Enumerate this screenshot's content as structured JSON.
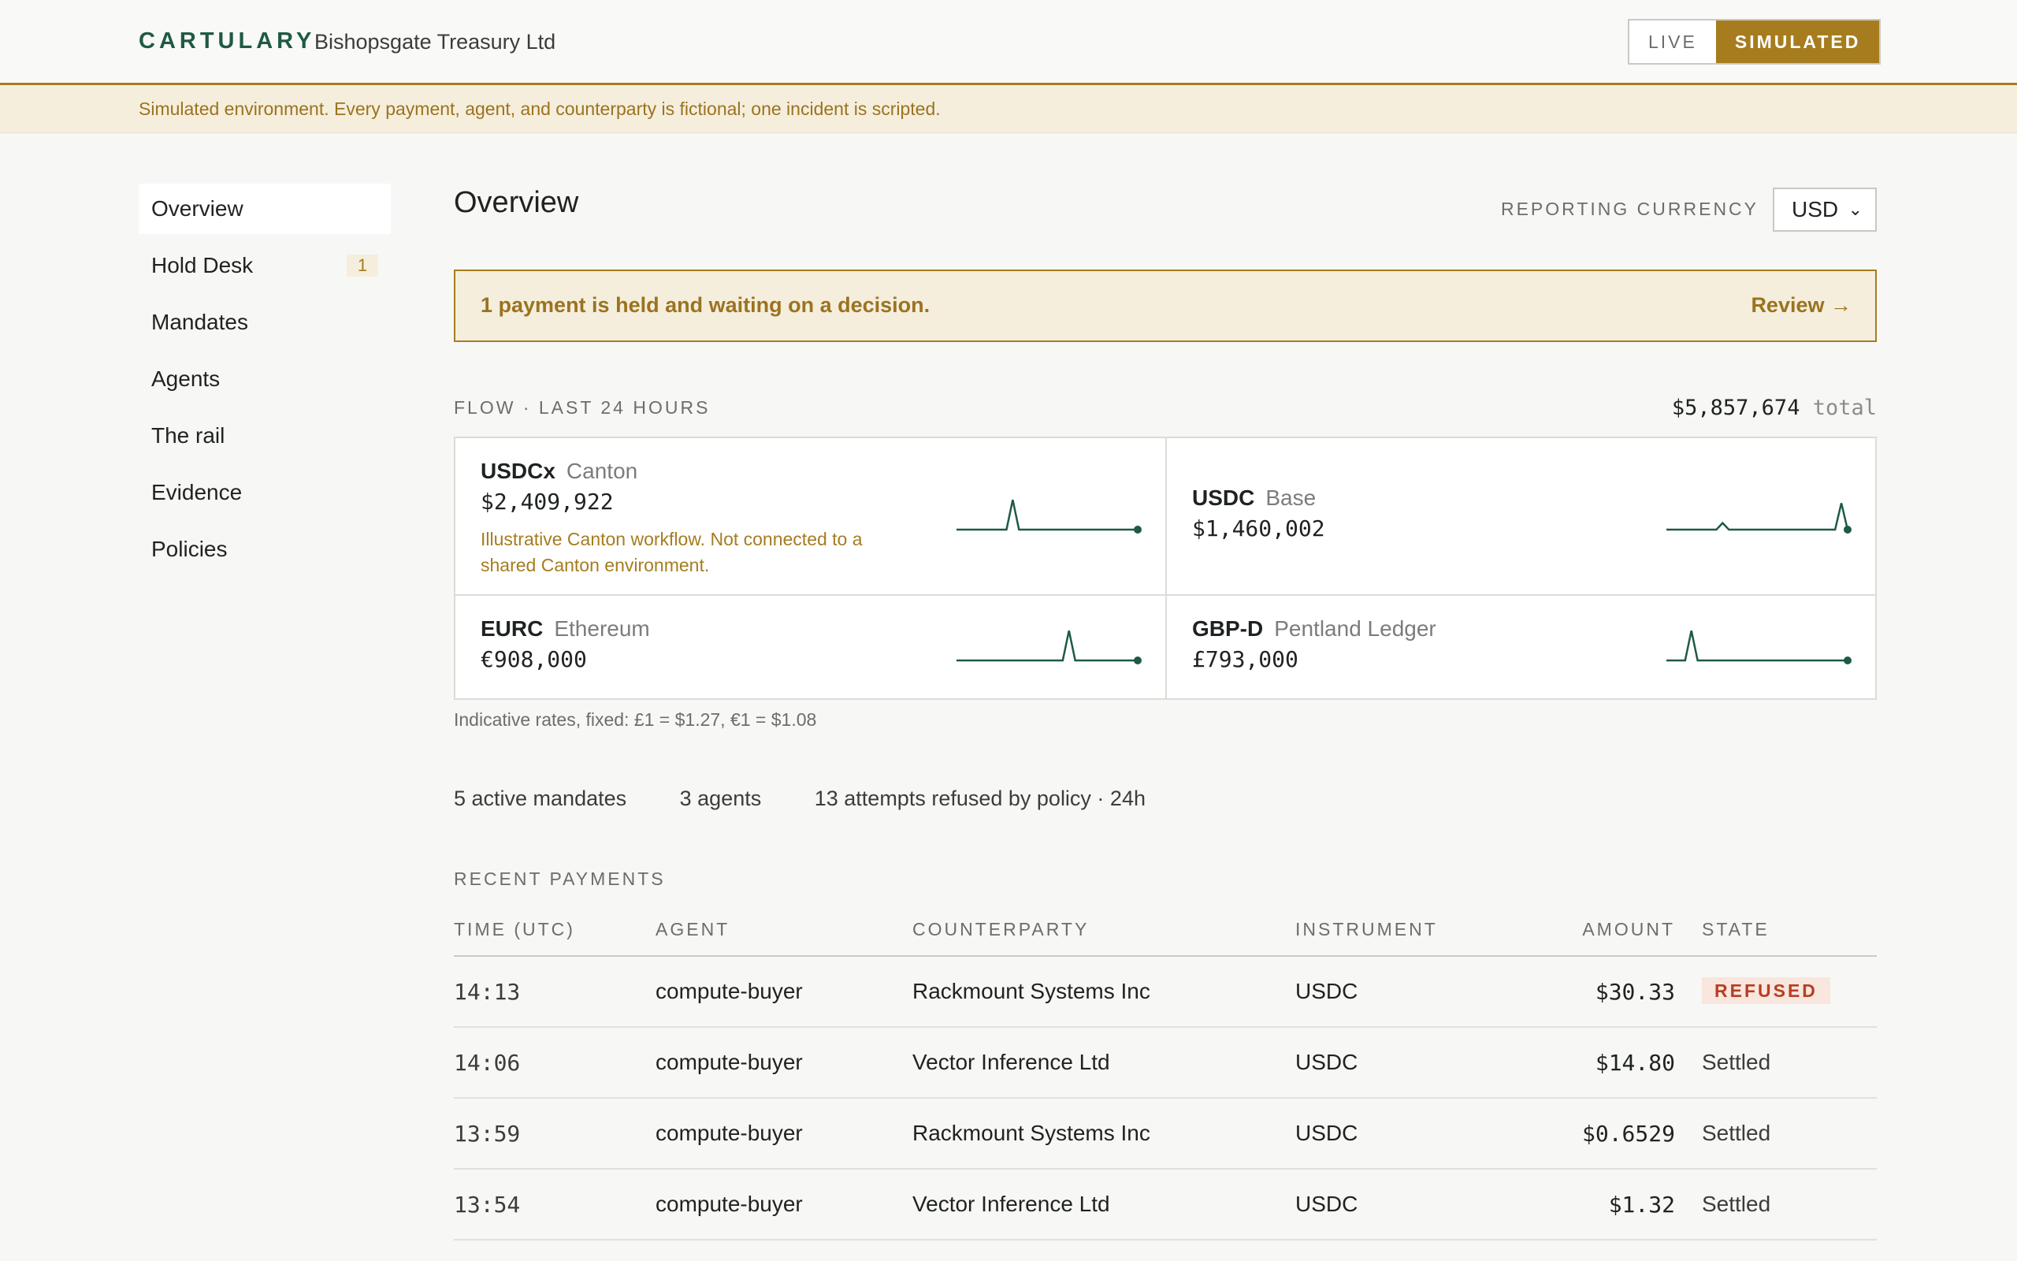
{
  "header": {
    "brand": "CARTULARY",
    "org": "Bishopsgate Treasury Ltd",
    "env_live": "LIVE",
    "env_simulated": "SIMULATED"
  },
  "banner": "Simulated environment. Every payment, agent, and counterparty is fictional; one incident is scripted.",
  "sidebar": {
    "items": [
      {
        "label": "Overview",
        "active": true
      },
      {
        "label": "Hold Desk",
        "badge": "1"
      },
      {
        "label": "Mandates"
      },
      {
        "label": "Agents"
      },
      {
        "label": "The rail"
      },
      {
        "label": "Evidence"
      },
      {
        "label": "Policies"
      }
    ]
  },
  "main": {
    "title": "Overview",
    "currency_label": "REPORTING CURRENCY",
    "currency_value": "USD",
    "hold_alert": {
      "message": "1 payment is held and waiting on a decision.",
      "action": "Review →"
    },
    "flow": {
      "label": "FLOW · LAST 24 HOURS",
      "total": "$5,857,674",
      "total_unit": "total",
      "cards": [
        {
          "instrument": "USDCx",
          "network": "Canton",
          "amount": "$2,409,922",
          "note": "Illustrative Canton workflow. Not connected to a shared Canton environment.",
          "spark": [
            0,
            0,
            0,
            0,
            0,
            0,
            0,
            0,
            0,
            9,
            0,
            0,
            0,
            0,
            0,
            0,
            0,
            0,
            0,
            0,
            0,
            0,
            0,
            0,
            0,
            0,
            0,
            0,
            0,
            0
          ]
        },
        {
          "instrument": "USDC",
          "network": "Base",
          "amount": "$1,460,002",
          "spark": [
            0,
            0,
            0,
            0,
            0,
            0,
            0,
            0,
            0,
            2,
            0,
            0,
            0,
            0,
            0,
            0,
            0,
            0,
            0,
            0,
            0,
            0,
            0,
            0,
            0,
            0,
            0,
            0,
            8,
            0
          ]
        },
        {
          "instrument": "EURC",
          "network": "Ethereum",
          "amount": "€908,000",
          "spark": [
            0,
            0,
            0,
            0,
            0,
            0,
            0,
            0,
            0,
            0,
            0,
            0,
            0,
            0,
            0,
            0,
            0,
            0,
            9,
            0,
            0,
            0,
            0,
            0,
            0,
            0,
            0,
            0,
            0,
            0
          ]
        },
        {
          "instrument": "GBP-D",
          "network": "Pentland Ledger",
          "amount": "£793,000",
          "spark": [
            0,
            0,
            0,
            0,
            9,
            0,
            0,
            0,
            0,
            0,
            0,
            0,
            0,
            0,
            0,
            0,
            0,
            0,
            0,
            0,
            0,
            0,
            0,
            0,
            0,
            0,
            0,
            0,
            0,
            0
          ]
        }
      ],
      "rates_note": "Indicative rates, fixed: £1 = $1.27, €1 = $1.08"
    },
    "stats": [
      "5 active mandates",
      "3 agents",
      "13 attempts refused by policy · 24h"
    ],
    "recent": {
      "label": "RECENT PAYMENTS",
      "columns": [
        "TIME (UTC)",
        "AGENT",
        "COUNTERPARTY",
        "INSTRUMENT",
        "AMOUNT",
        "STATE"
      ],
      "rows": [
        {
          "time": "14:13",
          "agent": "compute-buyer",
          "counterparty": "Rackmount Systems Inc",
          "instrument": "USDC",
          "amount": "$30.33",
          "state": "REFUSED"
        },
        {
          "time": "14:06",
          "agent": "compute-buyer",
          "counterparty": "Vector Inference Ltd",
          "instrument": "USDC",
          "amount": "$14.80",
          "state": "Settled"
        },
        {
          "time": "13:59",
          "agent": "compute-buyer",
          "counterparty": "Rackmount Systems Inc",
          "instrument": "USDC",
          "amount": "$0.6529",
          "state": "Settled"
        },
        {
          "time": "13:54",
          "agent": "compute-buyer",
          "counterparty": "Vector Inference Ltd",
          "instrument": "USDC",
          "amount": "$1.32",
          "state": "Settled"
        }
      ]
    }
  },
  "colors": {
    "brand": "#1f5a43",
    "accent": "#a67c1f",
    "refused": "#b53f23",
    "spark": "#1f5a43"
  }
}
